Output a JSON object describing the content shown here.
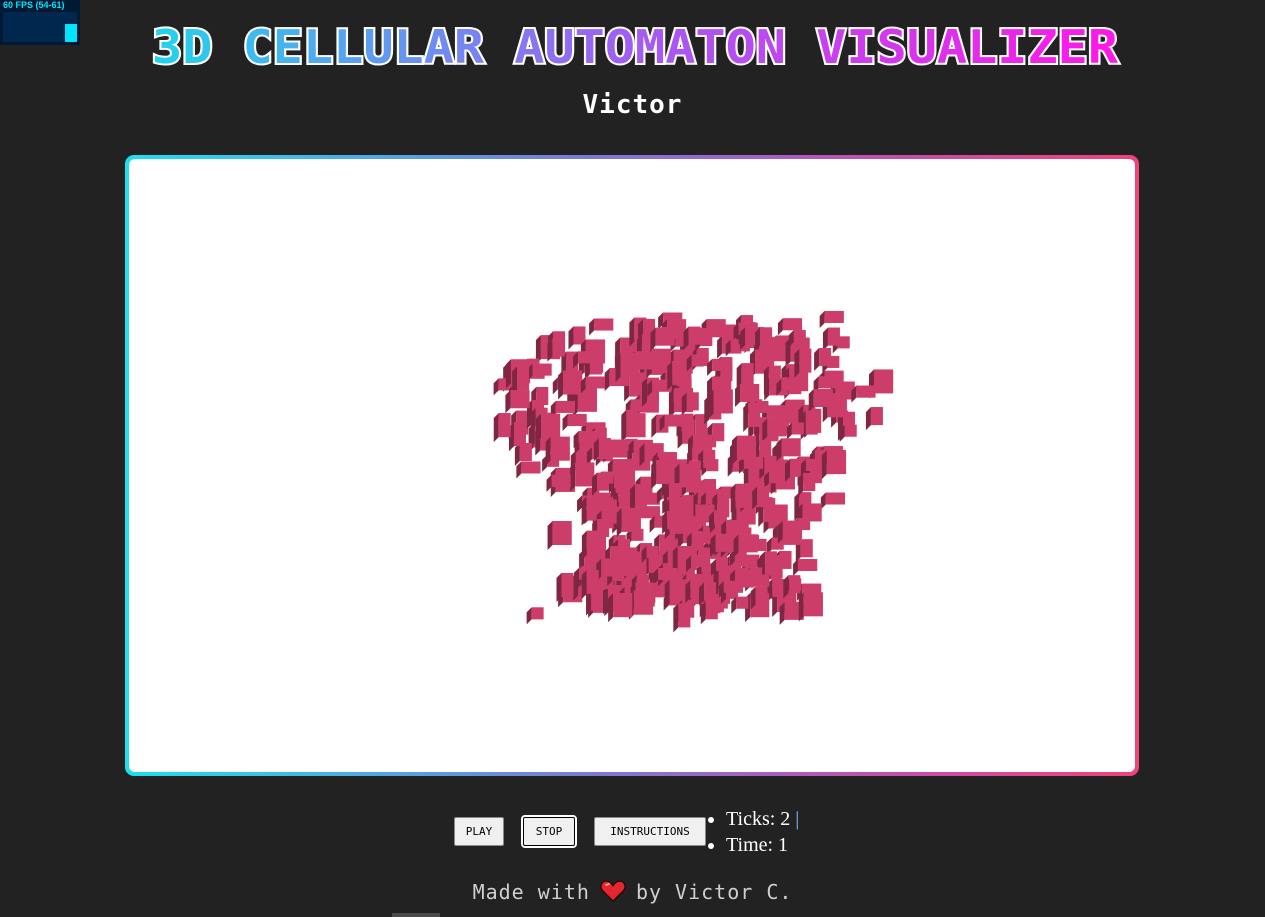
{
  "fps_widget": {
    "label": "60 FPS (54-61)",
    "current_fps_fraction": 0.6
  },
  "header": {
    "title": "3D CELLULAR AUTOMATON VISUALIZER",
    "subtitle": "Victor"
  },
  "visualizer": {
    "cube_color": "#cc3d6a",
    "frame_gradient": [
      "#1ee0ee",
      "#7a7bd6",
      "#c24fb0",
      "#f24278"
    ]
  },
  "controls": {
    "play_label": "PLAY",
    "stop_label": "STOP",
    "instructions_label": "INSTRUCTIONS"
  },
  "stats": {
    "ticks": "Ticks: 2",
    "separator": "|",
    "time": "Time: 1"
  },
  "footer": {
    "prefix": "Made with",
    "heart_icon": "heart-icon",
    "suffix": "by Victor C."
  },
  "colors": {
    "background": "#222222",
    "fps_accent": "#00e5ff",
    "title_gradient_start": "#22d3ee",
    "title_gradient_mid": "#a35cf2",
    "title_gradient_end": "#ff17e8"
  }
}
